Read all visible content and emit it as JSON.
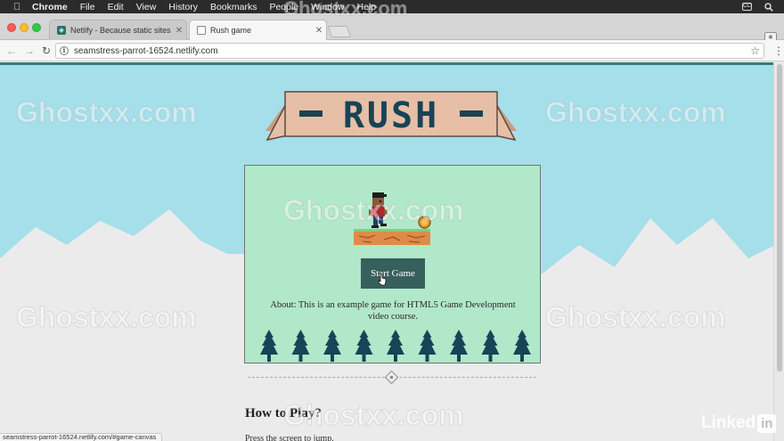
{
  "menubar": {
    "items": [
      "Chrome",
      "File",
      "Edit",
      "View",
      "History",
      "Bookmarks",
      "People",
      "Window",
      "Help"
    ],
    "cc_label": "CC"
  },
  "tabs": [
    {
      "label": "Netlify - Because static sites a",
      "favicon": "netlify-icon",
      "active": false
    },
    {
      "label": "Rush game",
      "favicon": "page-icon",
      "active": true
    }
  ],
  "address_bar": {
    "url": "seamstress-parrot-16524.netlify.com"
  },
  "game": {
    "title": "RUSH",
    "start_button": "Start Game",
    "about": "About: This is an example game for HTML5 Game Development video course."
  },
  "sections": {
    "how_to_play_title": "How to Play?",
    "how_to_play_text": "Press the screen to jump."
  },
  "status_url": "seamstress-parrot-16524.netlify.com/#game-canvas",
  "watermark": "Ghostxx.com",
  "branding": {
    "logo_text": "Linked",
    "logo_badge": "in"
  },
  "colors": {
    "sky": "#a5dfea",
    "snow": "#ecebec",
    "canvas": "#b1e8ca",
    "button": "#37605c",
    "banner": "#e7bfa7",
    "title": "#174456",
    "tree": "#174456"
  }
}
